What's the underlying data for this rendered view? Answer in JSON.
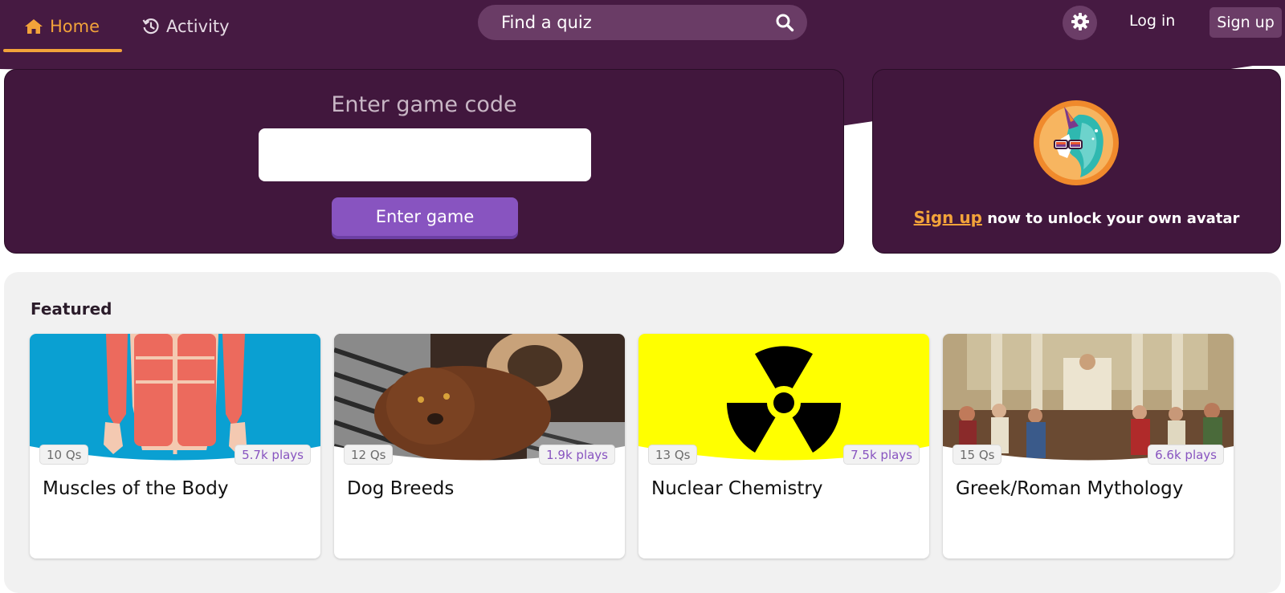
{
  "nav": {
    "home_label": "Home",
    "activity_label": "Activity",
    "search_placeholder": "Find a quiz",
    "login_label": "Log in",
    "signup_label": "Sign up"
  },
  "game": {
    "title": "Enter game code",
    "input_value": "",
    "button_label": "Enter game"
  },
  "avatar": {
    "signup_link": "Sign up",
    "unlock_text": " now to unlock your own avatar"
  },
  "featured": {
    "title": "Featured",
    "cards": [
      {
        "title": "Muscles of the Body",
        "questions": "10 Qs",
        "plays": "5.7k plays",
        "image": "muscles-illustration"
      },
      {
        "title": "Dog Breeds",
        "questions": "12 Qs",
        "plays": "1.9k plays",
        "image": "dog-photo"
      },
      {
        "title": "Nuclear Chemistry",
        "questions": "13 Qs",
        "plays": "7.5k plays",
        "image": "radiation-symbol"
      },
      {
        "title": "Greek/Roman Mythology",
        "questions": "15 Qs",
        "plays": "6.6k plays",
        "image": "mythology-painting"
      }
    ]
  },
  "colors": {
    "brand_purple": "#461a42",
    "accent_orange": "#f2a33a",
    "button_purple": "#8854c0"
  },
  "icons": {
    "home": "home-icon",
    "activity": "history-icon",
    "search": "search-icon",
    "settings": "gear-icon"
  }
}
